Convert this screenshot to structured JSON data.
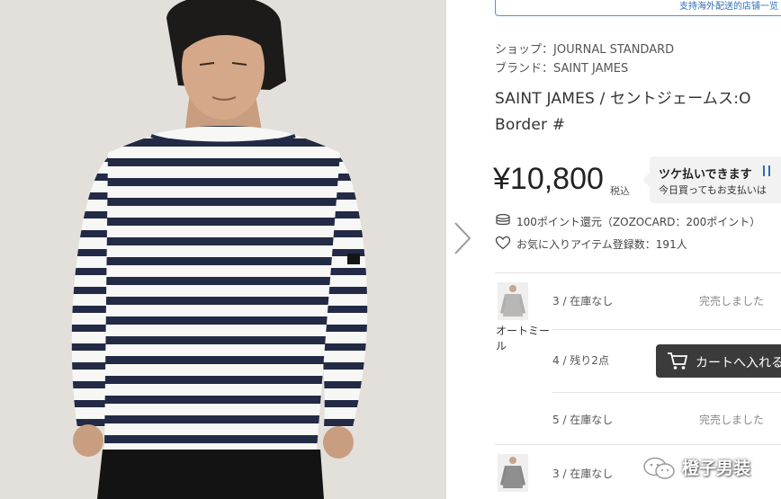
{
  "banner": {
    "text": "支持海外配送的店铺一览"
  },
  "meta": {
    "shop_label": "ショップ：",
    "shop_value": "JOURNAL STANDARD",
    "brand_label": "ブランド：",
    "brand_value": "SAINT JAMES"
  },
  "product": {
    "title": "SAINT JAMES / セントジェームス:O Border #",
    "price": "¥10,800",
    "tax_label": "税込"
  },
  "payment": {
    "title": "ツケ払いできます",
    "subtitle": "今日買ってもお支払いは"
  },
  "points": {
    "text": "100ポイント還元（ZOZOCARD：200ポイント）"
  },
  "favorites": {
    "text": "お気に入りアイテム登録数：191人"
  },
  "variants": {
    "color_name": "オートミール",
    "rows": [
      {
        "size": "3 / 在庫なし",
        "status": "完売しました"
      },
      {
        "size": "4 / 残り2点",
        "status": ""
      },
      {
        "size": "5 / 在庫なし",
        "status": "完売しました"
      },
      {
        "size": "3 / 在庫なし",
        "status": ""
      }
    ]
  },
  "cart": {
    "label": "カートへ入れる"
  },
  "watermark": {
    "text": "橙子男装"
  },
  "colors": {
    "accent_blue": "#2f6db3",
    "cart_button": "#3b3b3b",
    "stripe_navy": "#232a45"
  }
}
